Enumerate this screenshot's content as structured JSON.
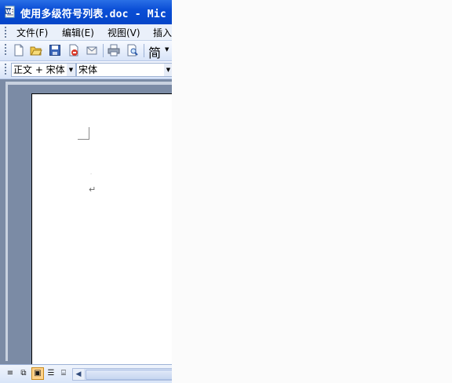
{
  "window": {
    "title": "使用多级符号列表.doc - Mic",
    "app_icon": "word-document-icon"
  },
  "menu": {
    "items": [
      {
        "label": "文件(F)",
        "name": "menu-file"
      },
      {
        "label": "编辑(E)",
        "name": "menu-edit"
      },
      {
        "label": "视图(V)",
        "name": "menu-view"
      },
      {
        "label": "插入",
        "name": "menu-insert"
      }
    ]
  },
  "toolbar": {
    "icons": [
      "new-document-icon",
      "open-folder-icon",
      "save-icon",
      "permission-icon",
      "email-icon",
      "print-icon",
      "print-preview-icon"
    ],
    "chinese_convert_label": "简"
  },
  "formatting": {
    "style_value": "正文 + 宋体",
    "font_value": "宋体"
  },
  "document": {
    "paragraph_mark": "↵",
    "small_mark": "ᐧ"
  },
  "statusbar": {
    "view_buttons": [
      "normal-view-icon",
      "web-layout-icon",
      "print-layout-icon",
      "outline-view-icon",
      "reading-layout-icon"
    ],
    "active_view": "print-layout-icon"
  },
  "colors": {
    "titlebar": "#0a4ed6",
    "workspace": "#7b8ba5",
    "page": "#ffffff"
  }
}
